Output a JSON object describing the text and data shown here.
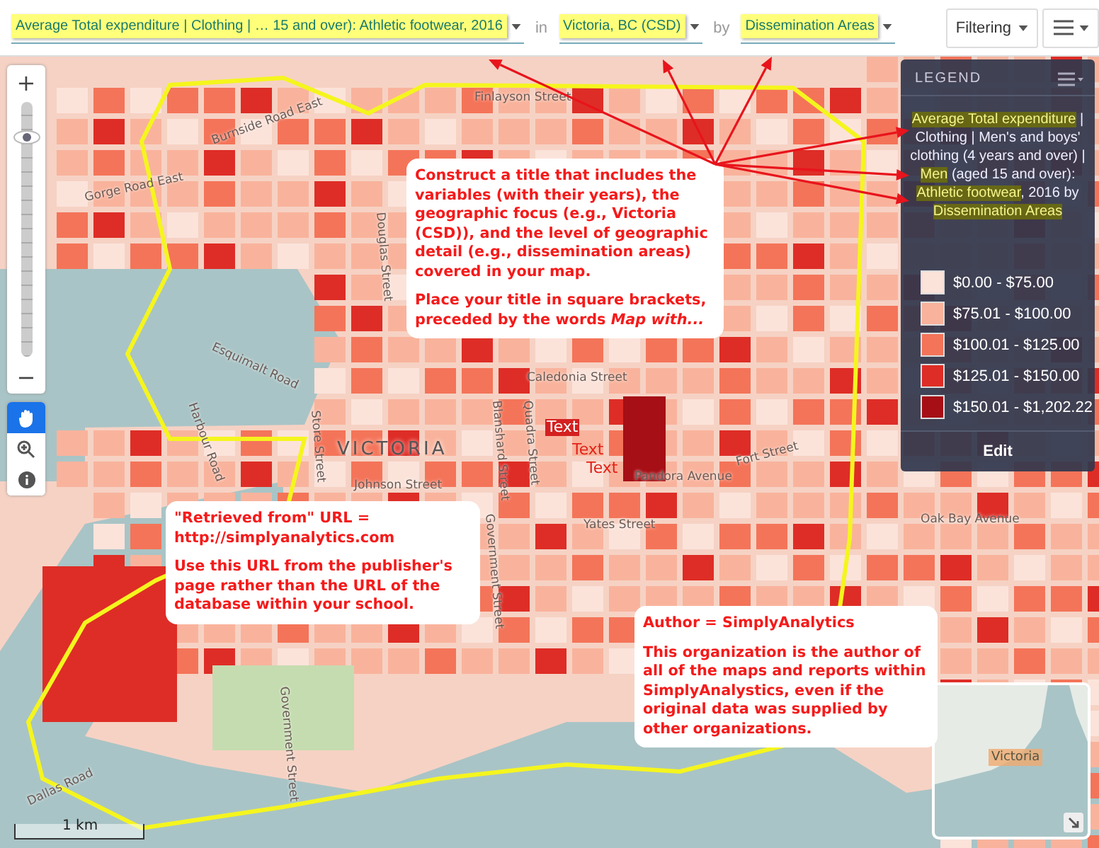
{
  "toolbar": {
    "variable_selector": "Average Total expenditure | Clothing | … 15 and over): Athletic footwear, 2016",
    "in_label": "in",
    "geography_selector": "Victoria, BC (CSD)",
    "by_label": "by",
    "level_selector": "Dissemination Areas",
    "filter_button": "Filtering"
  },
  "map_controls": {
    "zoom_in": "+",
    "zoom_out": "−",
    "level": 0.86,
    "tools": [
      {
        "kind": "pan",
        "selected": true
      },
      {
        "kind": "zoom",
        "selected": false
      },
      {
        "kind": "info",
        "selected": false
      }
    ]
  },
  "map": {
    "place_label": "VICTORIA",
    "street_labels": [
      "Finlayson Street",
      "Gorge Road East",
      "Burnside Road East",
      "Esquimalt Road",
      "Harbour Road",
      "Store Street",
      "Douglas Street",
      "Caledonia Street",
      "Blanshard Street",
      "Quadra Street",
      "Pandora Avenue",
      "Johnson Street",
      "Government Street",
      "Yates Street",
      "Fort Street",
      "Oak Bay Avenue",
      "Government Street",
      "Dallas Road"
    ],
    "text_markers": [
      "Text",
      "Text",
      "Text"
    ],
    "scale": "1 km",
    "inset_map": {
      "label": "Victoria"
    }
  },
  "legend": {
    "header": "LEGEND",
    "title": [
      {
        "text": "Average Total expenditure",
        "highlighted": true
      },
      {
        "text": " | Clothing | Men's and boys' clothing (4 years and over) | ",
        "highlighted": false
      },
      {
        "text": "Men",
        "highlighted": true
      },
      {
        "text": " (aged 15 and over): ",
        "highlighted": false
      },
      {
        "text": "Athletic footwear",
        "highlighted": true
      },
      {
        "text": ", 2016 by ",
        "highlighted": false
      },
      {
        "text": "Dissemination Areas",
        "highlighted": true
      }
    ],
    "classes": [
      {
        "label": "$0.00 - $75.00",
        "color": "#fbe3da"
      },
      {
        "label": "$75.01 - $100.00",
        "color": "#f9b39c"
      },
      {
        "label": "$100.01 - $125.00",
        "color": "#f47459"
      },
      {
        "label": "$125.01 - $150.00",
        "color": "#de2d26"
      },
      {
        "label": "$150.01 - $1,202.22",
        "color": "#a50f15"
      }
    ],
    "edit_button": "Edit"
  },
  "annotations": [
    {
      "paragraphs": [
        "Construct a title that includes the variables (with their years), the geographic focus (e.g., Victoria (CSD)), and the level of geographic detail (e.g., dissemination areas) covered in your map.",
        "Place your title in square brackets, preceded by the words *Map with...*"
      ]
    },
    {
      "paragraphs": [
        "\"Retrieved from\" URL = http://simplyanalytics.com",
        "Use this URL from the publisher's page rather than the URL of the database within your school."
      ]
    },
    {
      "paragraphs": [
        "Author = SimplyAnalytics",
        "This organization is the author of all of the maps and reports within SimplyAnalystics, even if the original data was supplied by other organizations."
      ]
    }
  ]
}
